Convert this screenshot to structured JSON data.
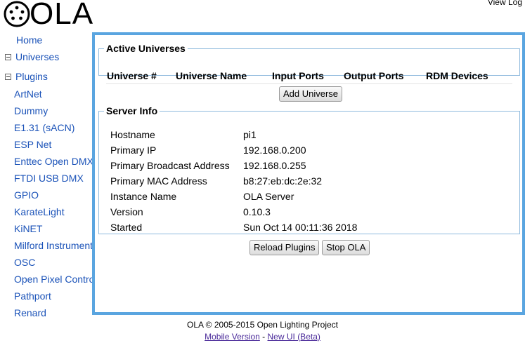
{
  "header": {
    "logo_text": "OLA",
    "view_log": "View Log"
  },
  "sidebar": {
    "home": "Home",
    "universes": "Universes",
    "plugins_label": "Plugins",
    "plugins": [
      "ArtNet",
      "Dummy",
      "E1.31 (sACN)",
      "ESP Net",
      "Enttec Open DMX",
      "FTDI USB DMX",
      "GPIO",
      "KarateLight",
      "KiNET",
      "Milford Instruments",
      "OSC",
      "Open Pixel Control",
      "Pathport",
      "Renard"
    ]
  },
  "universes": {
    "legend": "Active Universes",
    "columns": [
      "Universe #",
      "Universe Name",
      "Input Ports",
      "Output Ports",
      "RDM Devices"
    ],
    "add_button": "Add Universe"
  },
  "server": {
    "legend": "Server Info",
    "rows": [
      {
        "label": "Hostname",
        "value": "pi1"
      },
      {
        "label": "Primary IP",
        "value": "192.168.0.200"
      },
      {
        "label": "Primary Broadcast Address",
        "value": "192.168.0.255"
      },
      {
        "label": "Primary MAC Address",
        "value": "b8:27:eb:dc:2e:32"
      },
      {
        "label": "Instance Name",
        "value": "OLA Server"
      },
      {
        "label": "Version",
        "value": "0.10.3"
      },
      {
        "label": "Started",
        "value": "Sun Oct 14 00:11:36 2018"
      }
    ],
    "reload_button": "Reload Plugins",
    "stop_button": "Stop OLA"
  },
  "footer": {
    "copyright": "OLA © 2005-2015 Open Lighting Project",
    "mobile_link": "Mobile Version",
    "separator": " - ",
    "new_ui_link": "New UI (Beta)"
  },
  "colors": {
    "panel_border": "#5aa5e0",
    "link": "#1a52b8"
  }
}
